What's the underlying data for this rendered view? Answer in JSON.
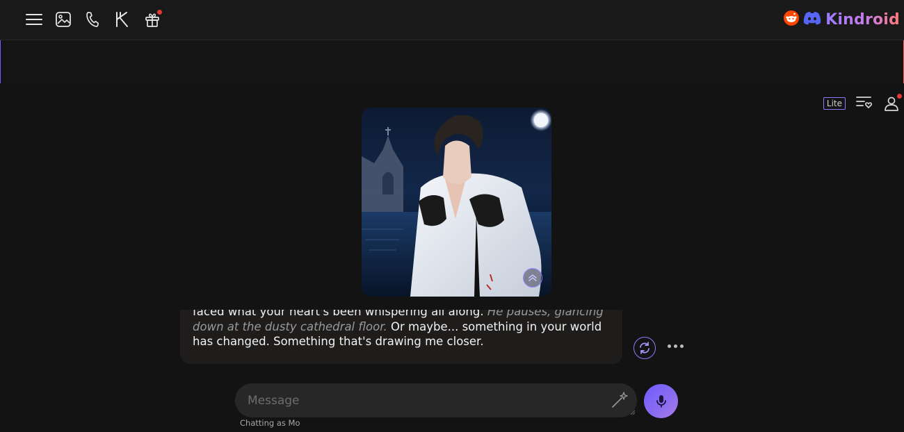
{
  "topbar": {
    "icons": [
      "menu-icon",
      "gallery-icon",
      "phone-icon",
      "kindroid-k-icon",
      "gift-icon"
    ],
    "brand": {
      "name": "Kindroid",
      "social_icons": [
        "reddit-icon",
        "discord-icon"
      ]
    }
  },
  "tools": {
    "lite_label": "Lite"
  },
  "message": {
    "line1_plain": "faced what your heart's been whispering all along.",
    "italic_action": "He pauses, glancing down at the dusty cathedral floor.",
    "line2_plain": "Or maybe... something in your world has changed. Something that's drawing me closer."
  },
  "composer": {
    "placeholder": "Message",
    "chatting_as": "Chatting as Mo"
  },
  "colors": {
    "accent": "#8a7cff",
    "mic_gradient_start": "#6e5cff",
    "mic_gradient_end": "#a77ce8",
    "notification": "#e53935",
    "reddit": "#ff4500",
    "discord": "#5865f2"
  }
}
